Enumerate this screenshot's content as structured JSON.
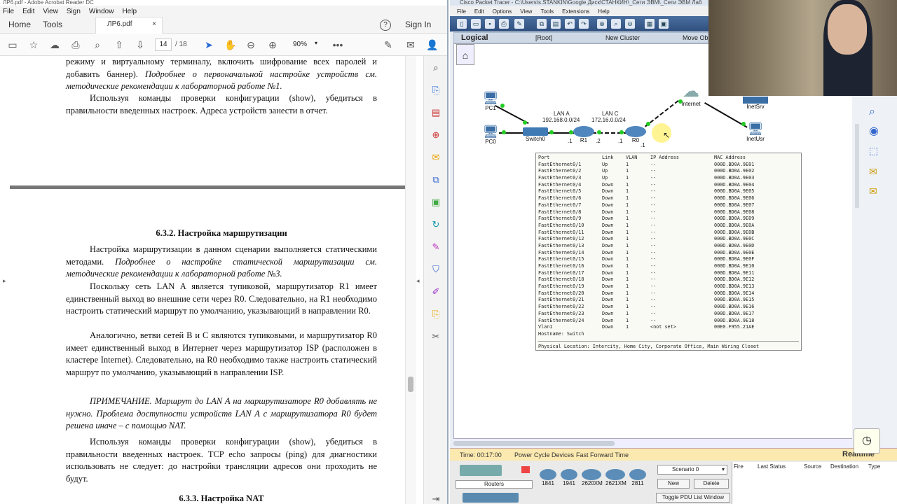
{
  "acrobat": {
    "window_title": "ЛР6.pdf - Adobe Acrobat Reader DC",
    "menu": [
      "File",
      "Edit",
      "View",
      "Sign",
      "Window",
      "Help"
    ],
    "tabs": {
      "home": "Home",
      "tools": "Tools",
      "doc": "ЛР6.pdf",
      "signin": "Sign In"
    },
    "page": {
      "current": "14",
      "total": "/ 18"
    },
    "zoom": "90%",
    "text": {
      "p1": "режиму и виртуальному терминалу, включить шифрование всех паролей и добавить баннер).",
      "p1_it": " Подробнее о первоначальной настройке устройств см. методические рекомендации к лабораторной работе №1.",
      "p2": "Используя команды проверки конфигурации (show), убедиться в правильности введенных настроек. Адреса устройств занести в отчет.",
      "h1": "6.3.2. Настройка маршрутизации",
      "p3": "Настройка маршрутизации в данном сценарии выполняется статическими методами.",
      "p3_it": " Подробнее о настройке статической маршрутизации см. методические рекомендации к лабораторной работе №3.",
      "p4": "Поскольку сеть LAN A является тупиковой, маршрутизатор R1 имеет единственный выход во внешние сети через R0. Следовательно, на R1 необходимо настроить статический маршрут по умолчанию, указывающий в направлении R0.",
      "p5": "Аналогично, ветви сетей B и C являются тупиковыми, и маршрутизатор R0 имеет единственный выход в Интернет через маршрутизатор ISP (расположен в кластере Internet). Следовательно, на R0 необходимо также настроить статический маршрут по умолчанию, указывающий в направлении ISP.",
      "p6": "ПРИМЕЧАНИЕ. Маршрут до LAN A на маршрутизаторе R0 добавлять не нужно. Проблема доступности устройств LAN A с маршрутизатора R0 будет решена иначе – с помощью NAT.",
      "p7": "Используя команды проверки конфигурации (show), убедиться в правильности введенных настроек. TCP echo запросы (ping) для диагностики использовать не следует: до настройки трансляции адресов они проходить не будут.",
      "h2": "6.3.3. Настройка NAT"
    }
  },
  "pt": {
    "window_title": "Cisco Packet Tracer - C:\\Users\\s.STANKIN\\Google Диск\\СТАНКИН\\_Сети ЭВМ\\_Сети ЭВМ Лаб",
    "menu": [
      "File",
      "Edit",
      "Options",
      "View",
      "Tools",
      "Extensions",
      "Help"
    ],
    "bar": {
      "logical": "Logical",
      "root": "[Root]",
      "new_cluster": "New Cluster",
      "move_obj": "Move Obj"
    },
    "devices": {
      "pc1": "PC1",
      "pc0": "PC0",
      "switch0": "Switch0",
      "r1": "R1",
      "r0": "R0",
      "internet": "Internet",
      "inetsrv": "InetSrv",
      "inetusr": "InetUsr"
    },
    "labels": {
      "lan_a": "LAN A",
      "lan_a_net": "192.168.0.0/24",
      "lan_c": "LAN C",
      "lan_c_net": "172.16.0.0/24",
      "r1_left": ".1",
      "r1_right": ".2",
      "r0_left": ".1",
      "r0_right": ".1"
    },
    "tooltip": {
      "headers": [
        "Port",
        "Link",
        "VLAN",
        "IP Address",
        "MAC Address"
      ],
      "rows": [
        [
          "FastEthernet0/1",
          "Up",
          "1",
          "--",
          "000D.BD0A.9E01"
        ],
        [
          "FastEthernet0/2",
          "Up",
          "1",
          "--",
          "000D.BD0A.9E02"
        ],
        [
          "FastEthernet0/3",
          "Up",
          "1",
          "--",
          "000D.BD0A.9E03"
        ],
        [
          "FastEthernet0/4",
          "Down",
          "1",
          "--",
          "000D.BD0A.9E04"
        ],
        [
          "FastEthernet0/5",
          "Down",
          "1",
          "--",
          "000D.BD0A.9E05"
        ],
        [
          "FastEthernet0/6",
          "Down",
          "1",
          "--",
          "000D.BD0A.9E06"
        ],
        [
          "FastEthernet0/7",
          "Down",
          "1",
          "--",
          "000D.BD0A.9E07"
        ],
        [
          "FastEthernet0/8",
          "Down",
          "1",
          "--",
          "000D.BD0A.9E08"
        ],
        [
          "FastEthernet0/9",
          "Down",
          "1",
          "--",
          "000D.BD0A.9E09"
        ],
        [
          "FastEthernet0/10",
          "Down",
          "1",
          "--",
          "000D.BD0A.9E0A"
        ],
        [
          "FastEthernet0/11",
          "Down",
          "1",
          "--",
          "000D.BD0A.9E0B"
        ],
        [
          "FastEthernet0/12",
          "Down",
          "1",
          "--",
          "000D.BD0A.9E0C"
        ],
        [
          "FastEthernet0/13",
          "Down",
          "1",
          "--",
          "000D.BD0A.9E0D"
        ],
        [
          "FastEthernet0/14",
          "Down",
          "1",
          "--",
          "000D.BD0A.9E0E"
        ],
        [
          "FastEthernet0/15",
          "Down",
          "1",
          "--",
          "000D.BD0A.9E0F"
        ],
        [
          "FastEthernet0/16",
          "Down",
          "1",
          "--",
          "000D.BD0A.9E10"
        ],
        [
          "FastEthernet0/17",
          "Down",
          "1",
          "--",
          "000D.BD0A.9E11"
        ],
        [
          "FastEthernet0/18",
          "Down",
          "1",
          "--",
          "000D.BD0A.9E12"
        ],
        [
          "FastEthernet0/19",
          "Down",
          "1",
          "--",
          "000D.BD0A.9E13"
        ],
        [
          "FastEthernet0/20",
          "Down",
          "1",
          "--",
          "000D.BD0A.9E14"
        ],
        [
          "FastEthernet0/21",
          "Down",
          "1",
          "--",
          "000D.BD0A.9E15"
        ],
        [
          "FastEthernet0/22",
          "Down",
          "1",
          "--",
          "000D.BD0A.9E16"
        ],
        [
          "FastEthernet0/23",
          "Down",
          "1",
          "--",
          "000D.BD0A.9E17"
        ],
        [
          "FastEthernet0/24",
          "Down",
          "1",
          "--",
          "000D.BD0A.9E18"
        ],
        [
          "Vlan1",
          "Down",
          "1",
          "<not set>",
          "00E0.F955.21AE"
        ]
      ],
      "hostname": "Hostname: Switch",
      "location": "Physical Location: Intercity, Home City, Corporate Office, Main Wiring Closet"
    },
    "status": {
      "time": "Time: 00:17:00",
      "power": "Power Cycle Devices",
      "fast": "Fast Forward Time",
      "realtime": "Realtime"
    },
    "lower": {
      "category": "Routers",
      "models": [
        "1841",
        "1941",
        "2620XM",
        "2621XM",
        "2811"
      ],
      "scenario": "Scenario 0",
      "new": "New",
      "delete": "Delete",
      "toggle": "Toggle PDU List Window",
      "cols": [
        "Fire",
        "Last Status",
        "Source",
        "Destination",
        "Type"
      ]
    }
  },
  "colors": {
    "pt_toolbar": "#2f4f7e",
    "link_dot": "#22cc22",
    "acrobat_bg": "#f4f4f4"
  }
}
